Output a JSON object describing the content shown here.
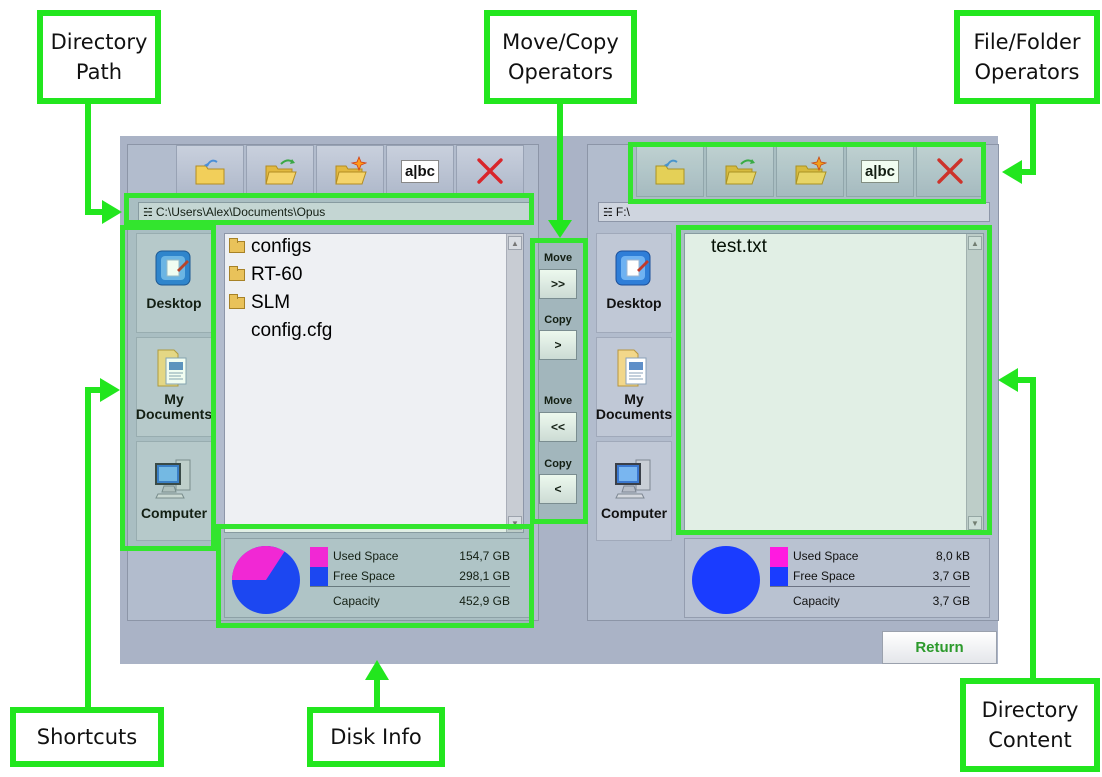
{
  "callouts": {
    "directory_path": "Directory\nPath",
    "move_copy": "Move/Copy\nOperators",
    "file_folder": "File/Folder\nOperators",
    "shortcuts": "Shortcuts",
    "disk_info": "Disk Info",
    "directory_content": "Directory\nContent"
  },
  "toolbar": {
    "icons": [
      "folder-up-icon",
      "folder-open-icon",
      "new-folder-icon",
      "rename-icon",
      "delete-icon"
    ],
    "rename_label": "a|bc"
  },
  "shortcuts": [
    {
      "label": "Desktop",
      "icon": "desktop-icon"
    },
    {
      "label": "My\nDocuments",
      "icon": "my-documents-icon"
    },
    {
      "label": "Computer",
      "icon": "computer-icon"
    }
  ],
  "left": {
    "path": "C:\\Users\\Alex\\Documents\\Opus",
    "items": [
      {
        "name": "configs",
        "type": "folder"
      },
      {
        "name": "RT-60",
        "type": "folder"
      },
      {
        "name": "SLM",
        "type": "folder"
      },
      {
        "name": "config.cfg",
        "type": "file"
      }
    ],
    "disk": {
      "used_label": "Used Space",
      "used_value": "154,7 GB",
      "free_label": "Free Space",
      "free_value": "298,1 GB",
      "capacity_label": "Capacity",
      "capacity_value": "452,9 GB",
      "used_fraction": 0.342
    }
  },
  "right": {
    "path": "F:\\",
    "items": [
      {
        "name": "test.txt",
        "type": "file"
      }
    ],
    "disk": {
      "used_label": "Used Space",
      "used_value": "8,0 kB",
      "free_label": "Free Space",
      "free_value": "3,7 GB",
      "capacity_label": "Capacity",
      "capacity_value": "3,7 GB",
      "used_fraction": 0.0
    }
  },
  "transfer": {
    "move_label": "Move",
    "copy_label": "Copy",
    "move_right": ">>",
    "copy_right": ">",
    "move_left": "<<",
    "copy_left": "<"
  },
  "return_label": "Return",
  "colors": {
    "highlight": "#33e52e",
    "used_space": "#ff1ae0",
    "free_space": "#1a3cff",
    "return_text": "#2c9a2c",
    "delete_red": "#d9262b"
  }
}
